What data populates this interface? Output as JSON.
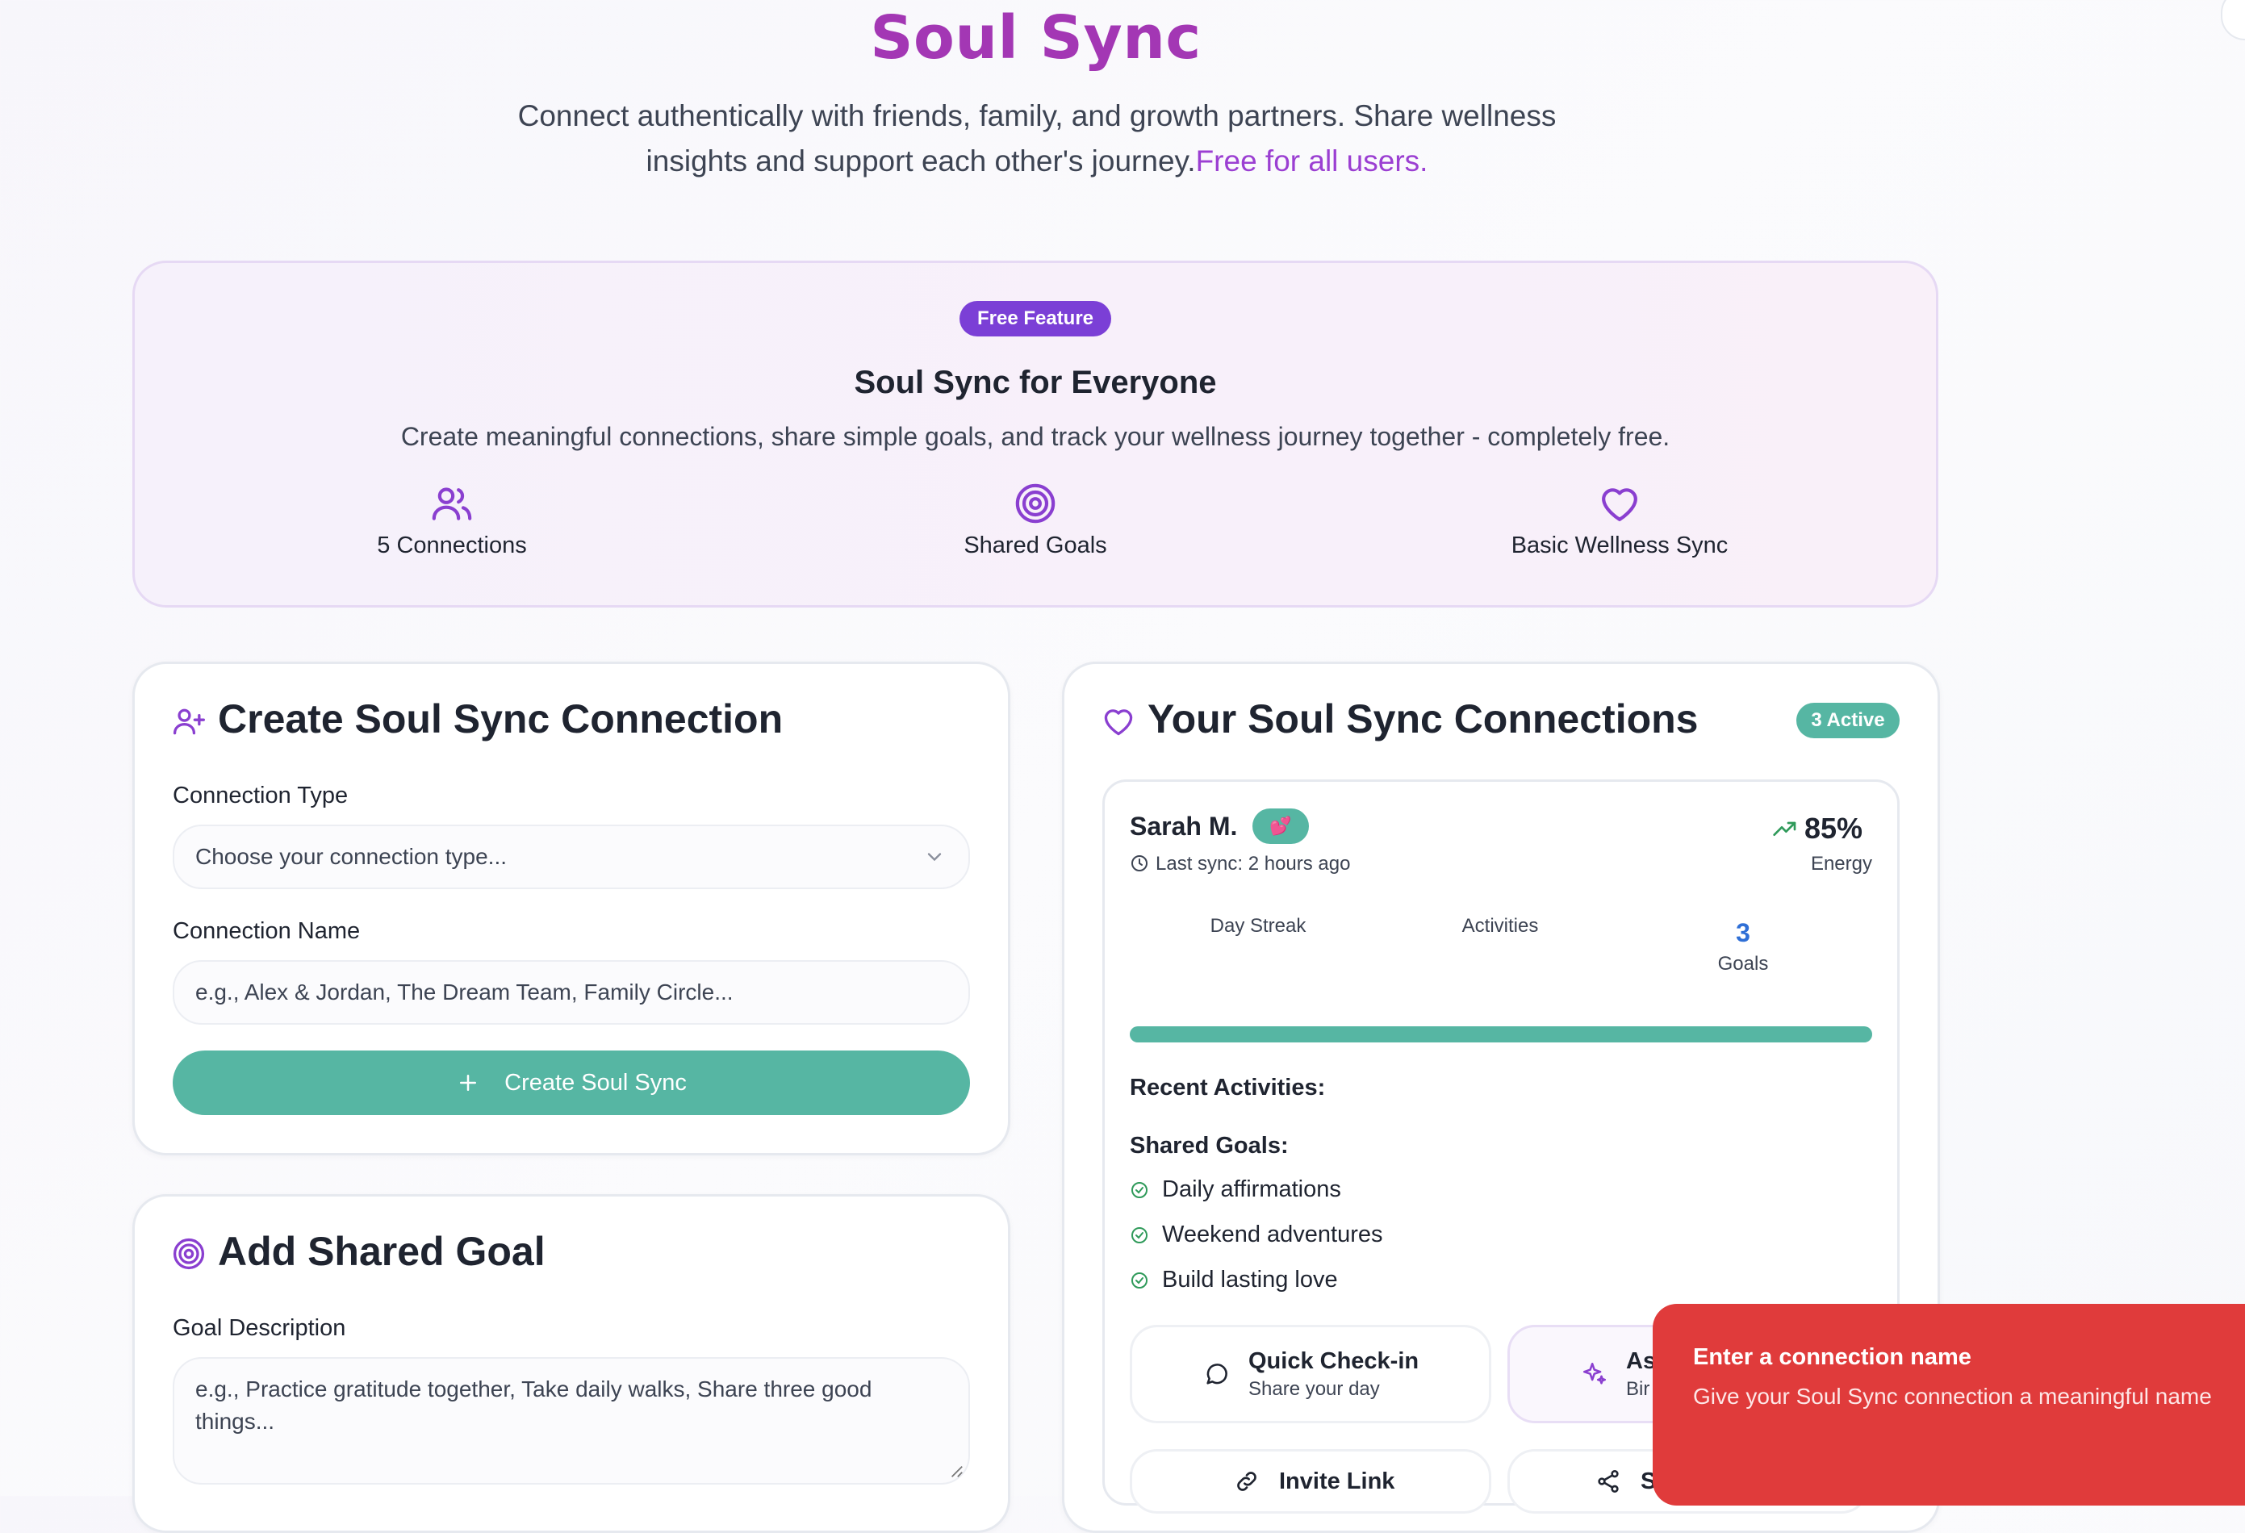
{
  "header": {
    "title": "Soul Sync",
    "subtitle_main": "Connect authentically with friends, family, and growth partners. Share wellness insights and support each other's journey.",
    "subtitle_accent": "Free for all users."
  },
  "banner": {
    "badge": "Free Feature",
    "title": "Soul Sync for Everyone",
    "description": "Create meaningful connections, share simple goals, and track your wellness journey together - completely free.",
    "features": [
      {
        "icon": "users-icon",
        "label": "5 Connections"
      },
      {
        "icon": "target-icon",
        "label": "Shared Goals"
      },
      {
        "icon": "heart-icon",
        "label": "Basic Wellness Sync"
      }
    ]
  },
  "create_card": {
    "title": "Create Soul Sync Connection",
    "type_label": "Connection Type",
    "type_placeholder": "Choose your connection type...",
    "name_label": "Connection Name",
    "name_placeholder": "e.g., Alex & Jordan, The Dream Team, Family Circle...",
    "button_label": "Create Soul Sync"
  },
  "goal_card": {
    "title": "Add Shared Goal",
    "desc_label": "Goal Description",
    "desc_placeholder": "e.g., Practice gratitude together, Take daily walks, Share three good things..."
  },
  "connections_card": {
    "title": "Your Soul Sync Connections",
    "active_badge": "3 Active",
    "connection": {
      "name": "Sarah M.",
      "badge_emoji": "💕",
      "last_sync": "Last sync: 2 hours ago",
      "energy_value": "85%",
      "energy_label": "Energy",
      "stats": [
        {
          "value": "",
          "label": "Day Streak"
        },
        {
          "value": "",
          "label": "Activities"
        },
        {
          "value": "3",
          "label": "Goals"
        }
      ],
      "progress": 1.0,
      "recent_label": "Recent Activities:",
      "goals_label": "Shared Goals:",
      "goals": [
        "Daily affirmations",
        "Weekend adventures",
        "Build lasting love"
      ],
      "actions": [
        {
          "title": "Quick Check-in",
          "sub": "Share your day"
        },
        {
          "title": "As",
          "sub": "Bir"
        },
        {
          "title": "Invite Link",
          "sub": ""
        },
        {
          "title": "Sh",
          "sub": ""
        }
      ]
    }
  },
  "toast": {
    "title": "Enter a connection name",
    "message": "Give your Soul Sync connection a meaningful name"
  },
  "colors": {
    "accent": "#9b3fd2",
    "primary": "#56b6a3",
    "error": "#e03b3b",
    "goals": "#2f6fd6"
  }
}
